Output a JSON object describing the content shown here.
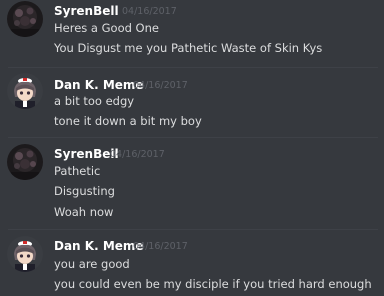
{
  "messages": [
    {
      "author": "SyrenBell",
      "timestamp": "04/16/2017",
      "lines": [
        "Heres a Good One",
        "You Disgust me you Pathetic Waste of Skin Kys"
      ]
    },
    {
      "author": "Dan K. Meme",
      "timestamp": "04/16/2017",
      "lines": [
        "a bit too edgy",
        "tone it down a bit my boy"
      ]
    },
    {
      "author": "SyrenBell",
      "timestamp": "04/16/2017",
      "lines": [
        "Pathetic",
        "Disgusting",
        "Woah now"
      ]
    },
    {
      "author": "Dan K. Meme",
      "timestamp": "04/16/2017",
      "lines": [
        "you are good",
        "you could even be my disciple if you tried hard enough"
      ]
    }
  ],
  "colors": {
    "background": "#36393e",
    "username": "#ffffff",
    "timestamp": "#5e6168",
    "message_text": "#dcddde"
  }
}
